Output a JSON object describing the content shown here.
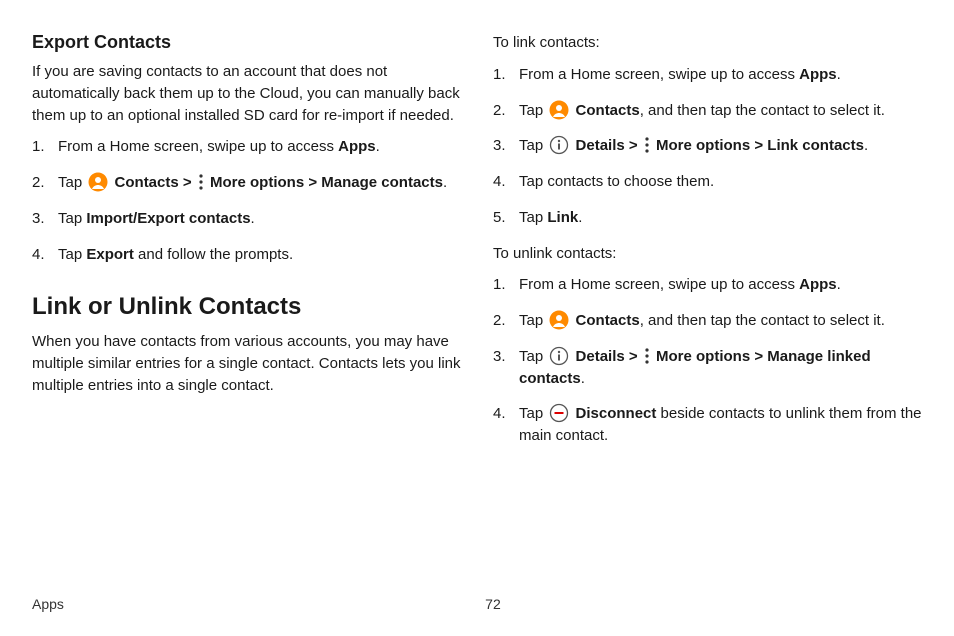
{
  "left": {
    "heading1": "Export Contacts",
    "p1": "If you are saving contacts to an account that does not automatically back them up to the Cloud, you can manually back them up to an optional installed SD card for re-import if needed.",
    "step1_a": "From a Home screen, swipe up to access ",
    "step1_b": "Apps",
    "step1_c": ".",
    "step2_a": "Tap ",
    "step2_b": "Contacts",
    "step2_c": " > ",
    "step2_d": "More options",
    "step2_e": " > ",
    "step2_f": "Manage contacts",
    "step2_g": ".",
    "step3_a": "Tap ",
    "step3_b": "Import/Export contacts",
    "step3_c": ".",
    "step4_a": "Tap ",
    "step4_b": "Export",
    "step4_c": " and follow the prompts.",
    "heading2": "Link or Unlink Contacts",
    "p2": "When you have contacts from various accounts, you may have multiple similar entries for a single contact. Contacts lets you link multiple entries into a single contact."
  },
  "right": {
    "linkLabel": "To link contacts:",
    "l1_a": "From a Home screen, swipe up to access ",
    "l1_b": "Apps",
    "l1_c": ".",
    "l2_a": "Tap ",
    "l2_b": "Contacts",
    "l2_c": ", and then tap the contact to select it.",
    "l3_a": "Tap ",
    "l3_b": "Details",
    "l3_c": " > ",
    "l3_d": "More options",
    "l3_e": " > ",
    "l3_f": "Link contacts",
    "l3_g": ".",
    "l4": "Tap contacts to choose them.",
    "l5_a": "Tap ",
    "l5_b": "Link",
    "l5_c": ".",
    "unlinkLabel": "To unlink contacts:",
    "u1_a": "From a Home screen, swipe up to access ",
    "u1_b": "Apps",
    "u1_c": ".",
    "u2_a": "Tap ",
    "u2_b": "Contacts",
    "u2_c": ", and then tap the contact to select it.",
    "u3_a": "Tap ",
    "u3_b": "Details",
    "u3_c": " > ",
    "u3_d": "More options",
    "u3_e": " > ",
    "u3_f": "Manage linked contacts",
    "u3_g": ".",
    "u4_a": "Tap ",
    "u4_b": "Disconnect",
    "u4_c": " beside contacts to unlink them from the main contact."
  },
  "footer": {
    "section": "Apps",
    "page": "72"
  }
}
